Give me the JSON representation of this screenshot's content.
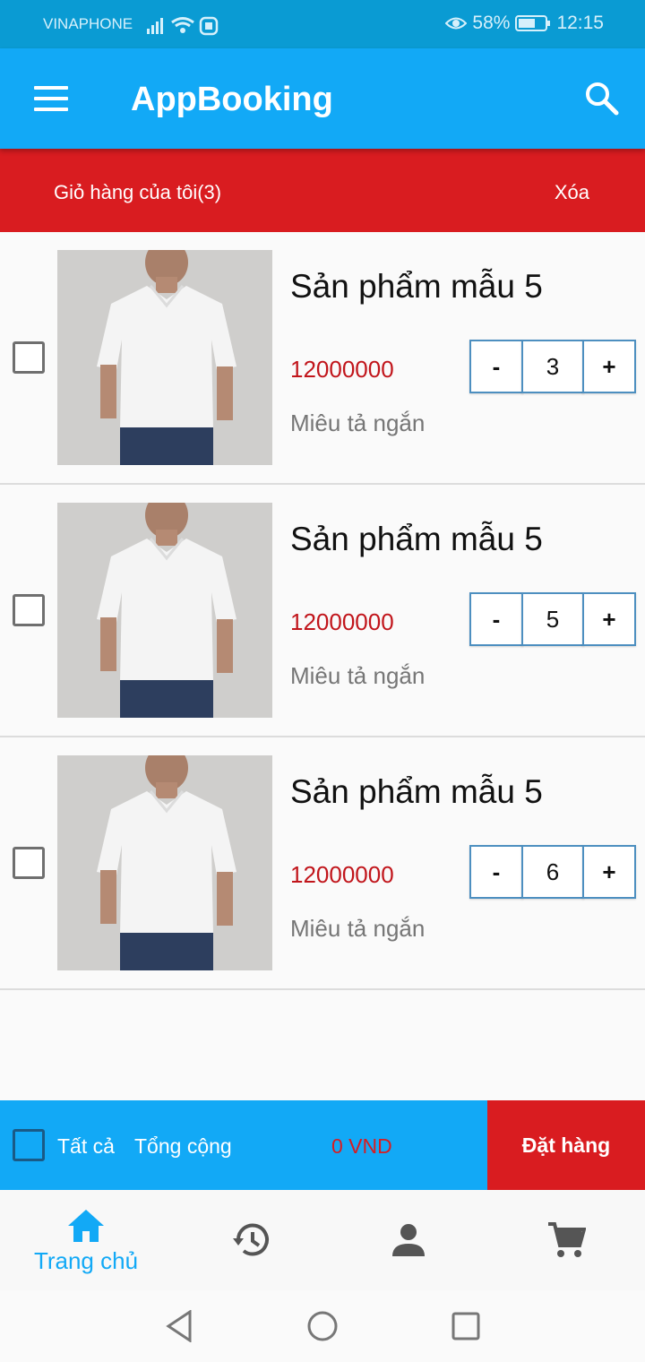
{
  "status_bar": {
    "carrier": "VINAPHONE",
    "battery": "58%",
    "time": "12:15"
  },
  "app_bar": {
    "title": "AppBooking",
    "menu_icon": "menu-icon",
    "search_icon": "search-icon"
  },
  "cart_header": {
    "title": "Giỏ hàng của tôi(3)",
    "delete_label": "Xóa"
  },
  "items": [
    {
      "name": "Sản phẩm mẫu 5",
      "price": "12000000",
      "description": "Miêu tả ngắn",
      "quantity": "3",
      "minus": "-",
      "plus": "+"
    },
    {
      "name": "Sản phẩm mẫu 5",
      "price": "12000000",
      "description": "Miêu tả ngắn",
      "quantity": "5",
      "minus": "-",
      "plus": "+"
    },
    {
      "name": "Sản phẩm mẫu 5",
      "price": "12000000",
      "description": "Miêu tả ngắn",
      "quantity": "6",
      "minus": "-",
      "plus": "+"
    }
  ],
  "summary": {
    "select_all_label": "Tất cả",
    "total_label": "Tổng cộng",
    "total_value": "0 VND",
    "order_label": "Đặt hàng"
  },
  "bottom_nav": {
    "home_label": "Trang chủ",
    "active": "home",
    "icons": [
      "home-icon",
      "history-icon",
      "account-icon",
      "cart-icon"
    ]
  },
  "colors": {
    "primary": "#12a9f6",
    "accent_red": "#d91c20",
    "price_red": "#c1151b"
  }
}
